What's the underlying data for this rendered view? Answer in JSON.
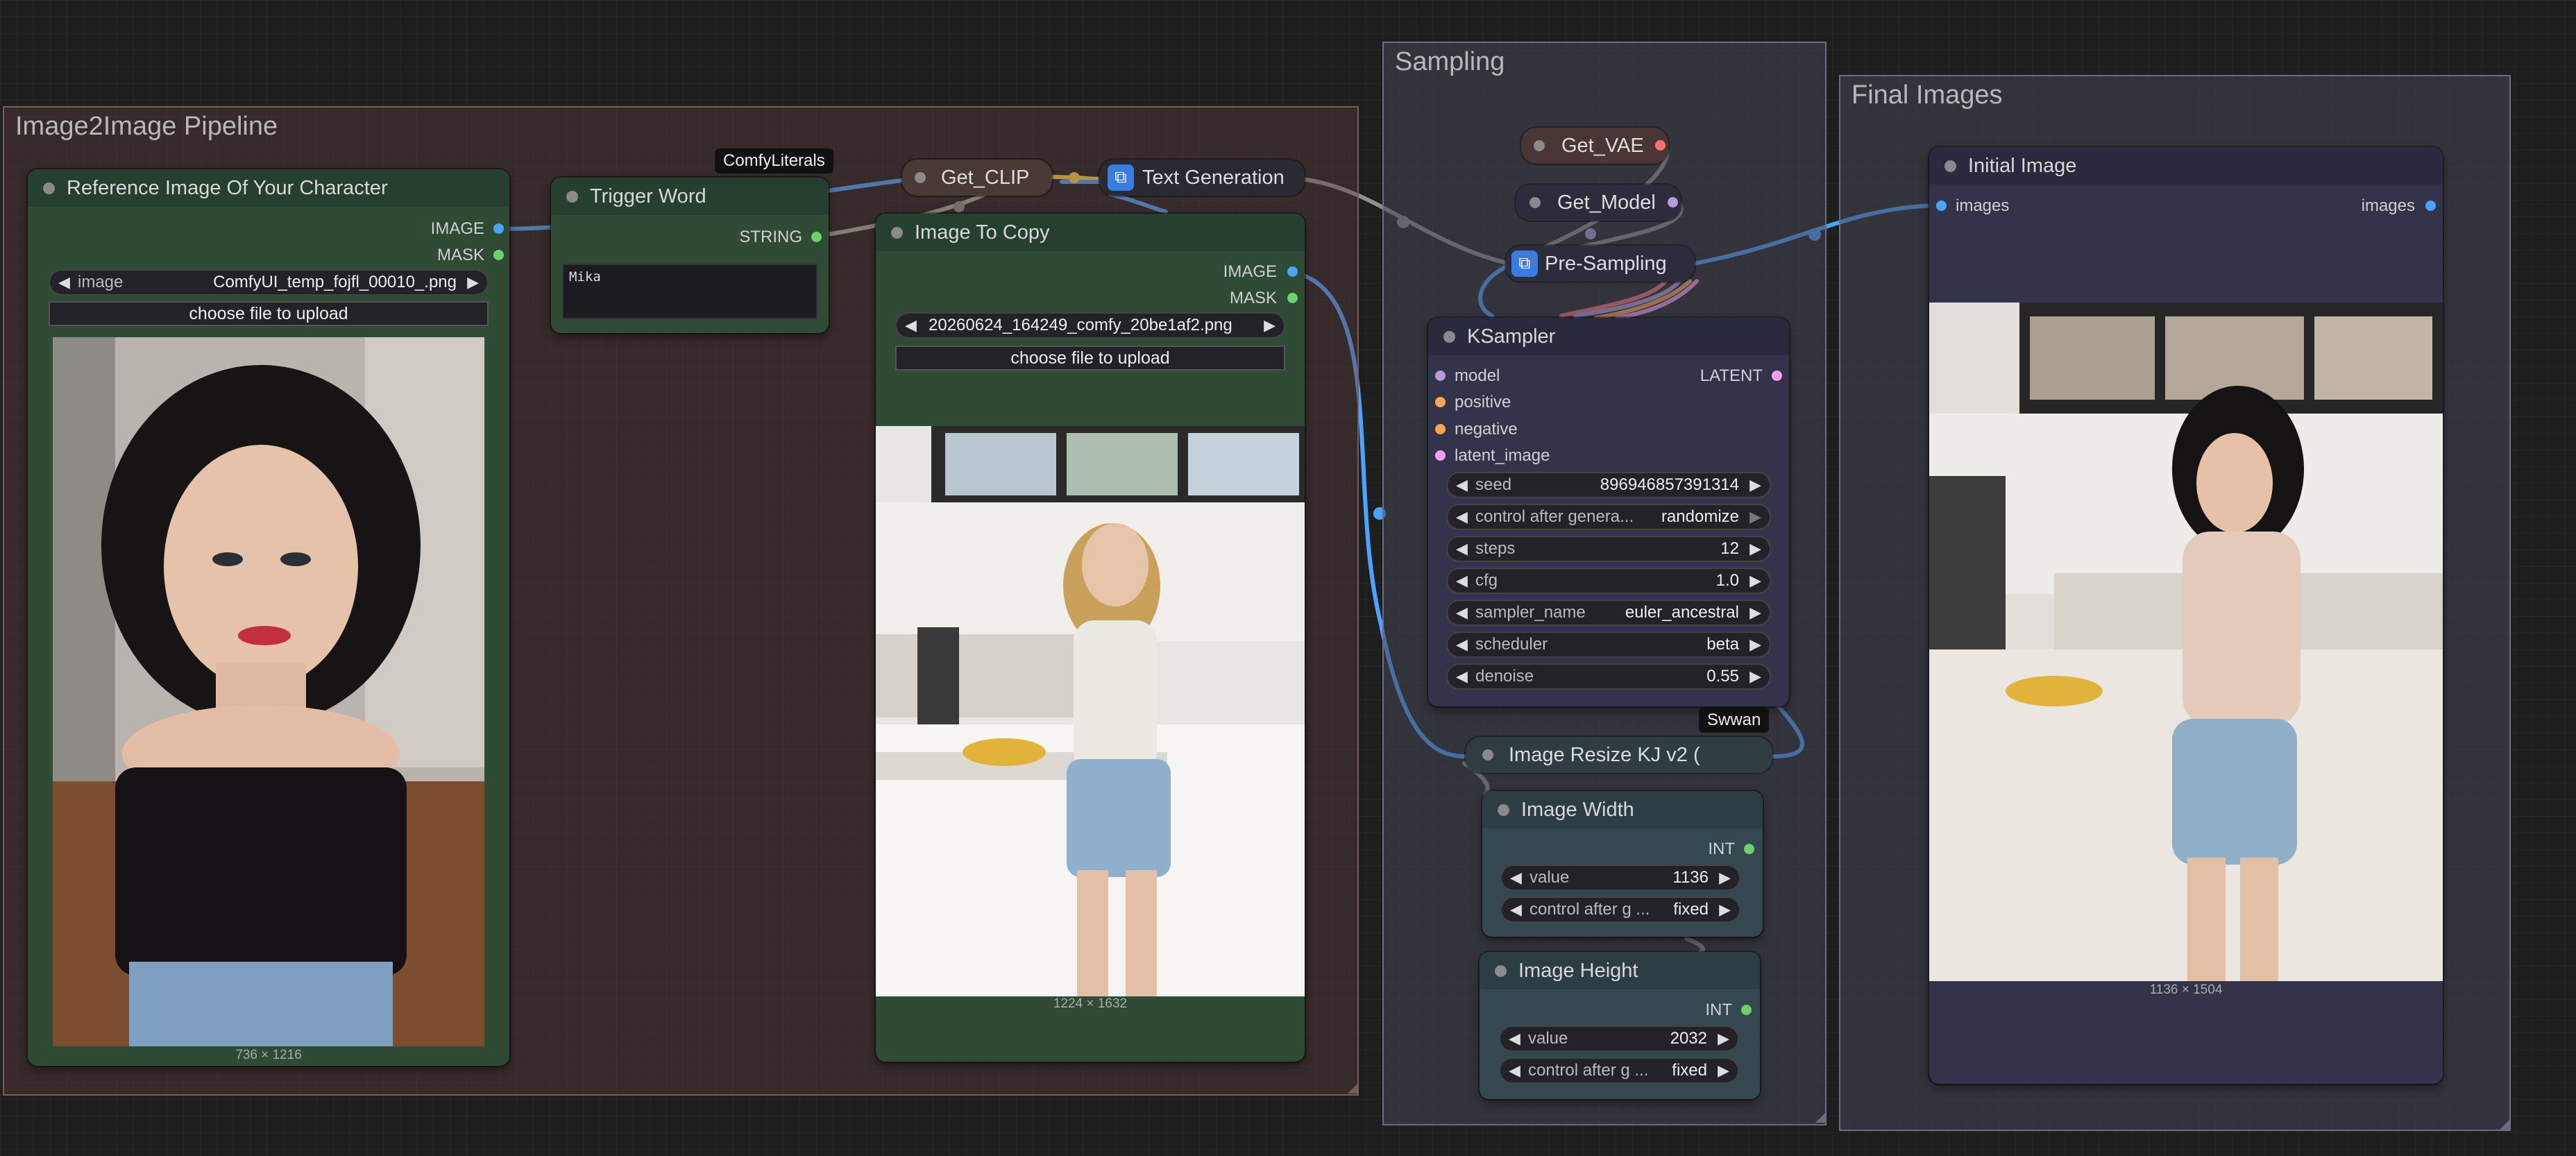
{
  "groups": {
    "pipeline": {
      "title": "Image2Image Pipeline"
    },
    "sampling": {
      "title": "Sampling"
    },
    "final": {
      "title": "Final Images"
    }
  },
  "ref_node": {
    "title": "Reference Image Of Your Character",
    "out_image": "IMAGE",
    "out_mask": "MASK",
    "image_label": "image",
    "image_value": "ComfyUI_temp_fojfl_00010_.png",
    "upload_label": "choose file to upload",
    "dims": "736 × 1216"
  },
  "trigger_node": {
    "title": "Trigger Word",
    "badge": "ComfyLiterals",
    "out_string": "STRING",
    "text": "Mika"
  },
  "get_clip": {
    "title": "Get_CLIP"
  },
  "text_gen": {
    "title": "Text Generation"
  },
  "copy_node": {
    "title": "Image To Copy",
    "out_image": "IMAGE",
    "out_mask": "MASK",
    "image_value": "20260624_164249_comfy_20be1af2.png",
    "upload_label": "choose file to upload",
    "dims": "1224 × 1632"
  },
  "get_vae": {
    "title": "Get_VAE"
  },
  "get_model": {
    "title": "Get_Model"
  },
  "pre_sampling": {
    "title": "Pre-Sampling"
  },
  "ksampler": {
    "title": "KSampler",
    "inputs": [
      "model",
      "positive",
      "negative",
      "latent_image"
    ],
    "output": "LATENT",
    "widgets": [
      {
        "label": "seed",
        "value": "896946857391314"
      },
      {
        "label": "control after genera...",
        "value": "randomize"
      },
      {
        "label": "steps",
        "value": "12"
      },
      {
        "label": "cfg",
        "value": "1.0"
      },
      {
        "label": "sampler_name",
        "value": "euler_ancestral"
      },
      {
        "label": "scheduler",
        "value": "beta"
      },
      {
        "label": "denoise",
        "value": "0.55"
      }
    ]
  },
  "swwan_badge": "Swwan",
  "resize_node": {
    "title": "Image Resize KJ v2 ("
  },
  "width_node": {
    "title": "Image Width",
    "out": "INT",
    "value_label": "value",
    "value": "1136",
    "control_label": "control after g ...",
    "control_value": "fixed"
  },
  "height_node": {
    "title": "Image Height",
    "out": "INT",
    "value_label": "value",
    "value": "2032",
    "control_label": "control after g ...",
    "control_value": "fixed"
  },
  "initial_node": {
    "title": "Initial Image",
    "in_images": "images",
    "out_images": "images",
    "dims": "1136 × 1504"
  },
  "colors": {
    "image_link": "#4aa3ff",
    "string_link": "#6fd06f",
    "clip_link": "#f6d64d",
    "vae_link": "#ff6f6f",
    "model_link": "#b39ddb",
    "conditioning_link": "#ffa64d",
    "latent_link": "#ff9cf0",
    "generic_link": "#8f8f8f"
  }
}
